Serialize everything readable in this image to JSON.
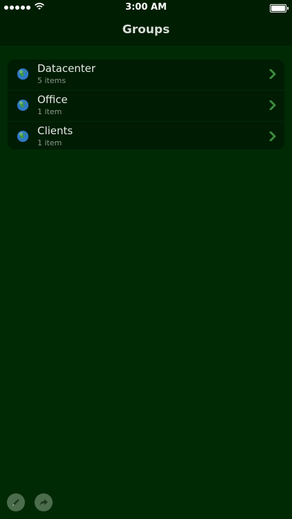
{
  "status_bar": {
    "time": "3:00 AM"
  },
  "nav": {
    "title": "Groups"
  },
  "groups": [
    {
      "name": "Datacenter",
      "count": "5 items"
    },
    {
      "name": "Office",
      "count": "1 item"
    },
    {
      "name": "Clients",
      "count": "1 item"
    }
  ],
  "icons": {
    "globe": "globe-icon",
    "chevron": "chevron-right-icon",
    "edit": "pencil-icon",
    "share": "share-arrow-icon"
  },
  "colors": {
    "background": "#002a04",
    "bar": "#001e02",
    "list": "#001c03",
    "chevron": "#3d8c3d",
    "toolbar_button": "#4c6d4c"
  }
}
